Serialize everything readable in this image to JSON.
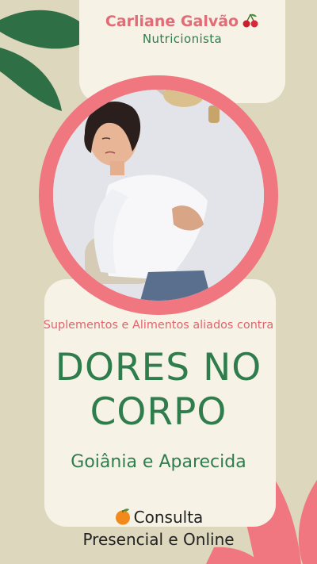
{
  "header": {
    "name": "Carliane Galvão",
    "role": "Nutricionista"
  },
  "icons": [
    "cherry-icon",
    "orange-icon",
    "leaf-decoration"
  ],
  "colors": {
    "background": "#dcd7bd",
    "card": "#f6f2e6",
    "accent_pink": "#f07680",
    "accent_green": "#2f7c4d",
    "leaf_green": "#2f6f45"
  },
  "content": {
    "tagline": "Suplementos e Alimentos aliados contra",
    "headline_line1": "DORES NO",
    "headline_line2": "CORPO",
    "location": "Goiânia e Aparecida",
    "consult_line1": "Consulta",
    "consult_line2": "Presencial e Online"
  }
}
